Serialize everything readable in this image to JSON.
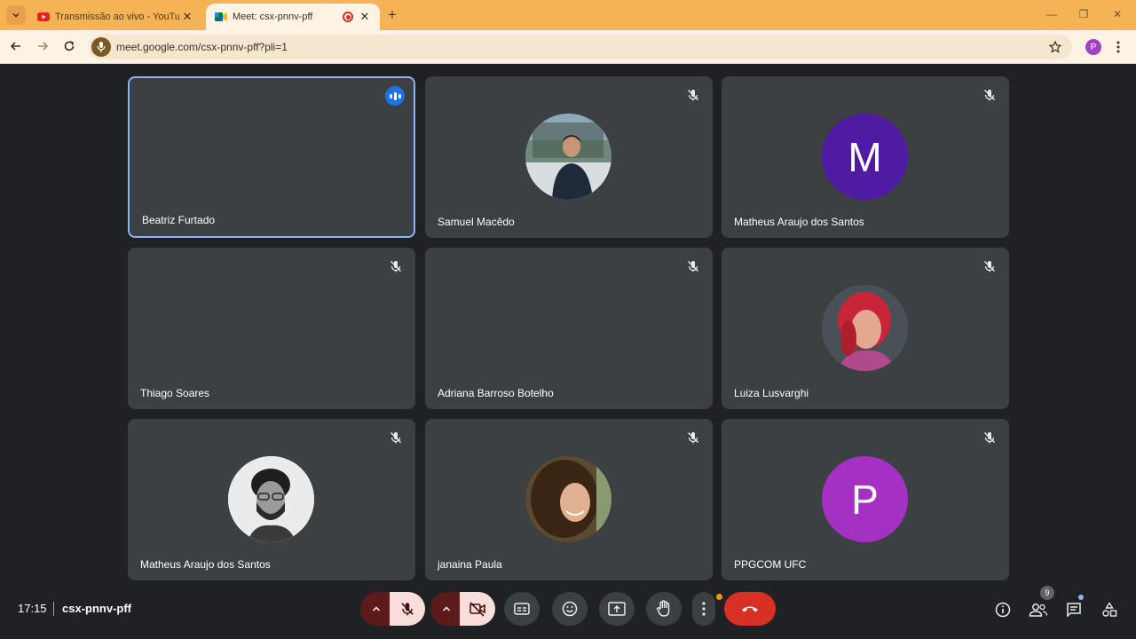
{
  "browser": {
    "tabs": [
      {
        "title": "Transmissão ao vivo - YouTube",
        "close": "✕"
      },
      {
        "title": "Meet: csx-pnnv-pff",
        "close": "✕"
      }
    ],
    "new_tab": "+",
    "url": "meet.google.com/csx-pnnv-pff?pli=1",
    "profile_initial": "P",
    "window_controls": {
      "minimize": "—",
      "restore": "❐",
      "close": "✕"
    }
  },
  "participants": [
    {
      "name": "Beatriz Furtado",
      "speaking": true,
      "avatar": "none"
    },
    {
      "name": "Samuel Macêdo",
      "muted": true,
      "avatar": "photo"
    },
    {
      "name": "Matheus Araujo dos Santos",
      "muted": true,
      "avatar": "letter",
      "initial": "M",
      "color": "#4e1ba2"
    },
    {
      "name": "Thiago Soares",
      "muted": true,
      "avatar": "none"
    },
    {
      "name": "Adriana Barroso Botelho",
      "muted": true,
      "avatar": "none"
    },
    {
      "name": "Luiza Lusvarghi",
      "muted": true,
      "avatar": "photo"
    },
    {
      "name": "Matheus Araujo dos Santos",
      "muted": true,
      "avatar": "photo"
    },
    {
      "name": "janaina Paula",
      "muted": true,
      "avatar": "photo"
    },
    {
      "name": "PPGCOM UFC",
      "muted": true,
      "avatar": "letter",
      "initial": "P",
      "color": "#a531c4"
    }
  ],
  "meeting": {
    "time": "17:15",
    "code": "csx-pnnv-pff",
    "people_count": "9"
  },
  "colors": {
    "accent": "#8ab4f8",
    "hangup": "#d93025",
    "tabbar": "#f6b356"
  }
}
